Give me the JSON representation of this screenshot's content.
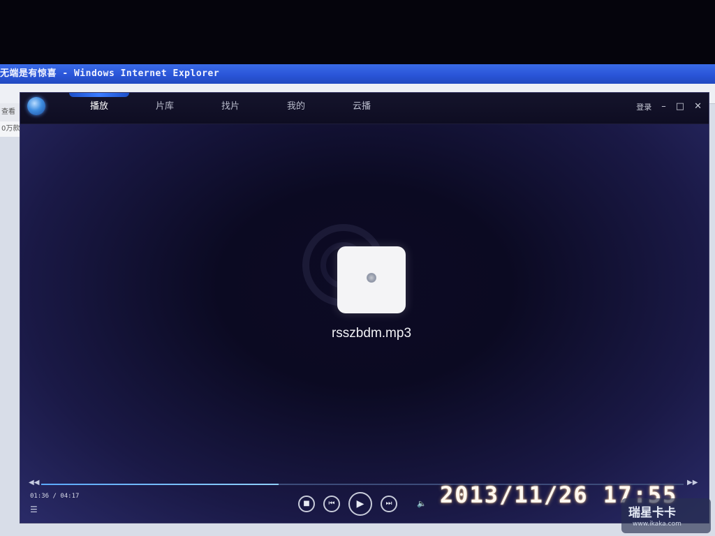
{
  "ie": {
    "title": "无端是有惊喜 - Windows Internet Explorer",
    "toolbar_text": "查看",
    "status_text": "0万款"
  },
  "player": {
    "tabs": [
      {
        "label": "播放",
        "active": true
      },
      {
        "label": "片库",
        "active": false
      },
      {
        "label": "找片",
        "active": false
      },
      {
        "label": "我的",
        "active": false
      },
      {
        "label": "云播",
        "active": false
      }
    ],
    "login_label": "登录",
    "minimize_glyph": "–",
    "maximize_glyph": "□",
    "close_glyph": "✕",
    "filename": "rsszbdm.mp3",
    "current_time": "01:36",
    "total_time": "04:17",
    "time_display": "01:36 / 04:17",
    "progress": 0.37,
    "seek_back_glyph": "◀◀",
    "seek_fwd_glyph": "▶▶",
    "stop_glyph": "■",
    "prev_glyph": "⏮",
    "play_glyph": "▶",
    "next_glyph": "⏭",
    "volume_glyph": "🔈",
    "playlist_glyph": "☰",
    "accent_color": "#3a7bff"
  },
  "overlay": {
    "timestamp": "2013/11/26 17:55"
  },
  "watermark": {
    "title": "瑞星卡卡",
    "url": "www.ikaka.com"
  }
}
